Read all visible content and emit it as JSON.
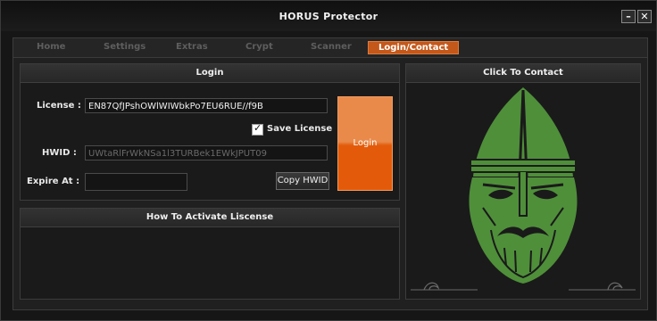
{
  "window": {
    "title": "HORUS  Protector",
    "minimize_icon": "minus",
    "close_icon": "x"
  },
  "tabs": [
    {
      "label": "Home",
      "active": false
    },
    {
      "label": "Settings",
      "active": false
    },
    {
      "label": "Extras",
      "active": false
    },
    {
      "label": "Crypt",
      "active": false
    },
    {
      "label": "Scanner",
      "active": false
    },
    {
      "label": "Login/Contact",
      "active": true
    }
  ],
  "login_panel": {
    "title": "Login",
    "license_label": "License :",
    "license_value": "EN87QfJPshOWlWIWbkPo7EU6RUE//f9B",
    "save_license_label": "Save License",
    "save_license_checked": true,
    "hwid_label": "HWID :",
    "hwid_value": "UWtaRlFrWkNSa1l3TURBek1EWkJPUT09",
    "expire_label": "Expire At  :",
    "expire_value": "",
    "login_button": "Login",
    "copy_hwid_button": "Copy HWID"
  },
  "activate_panel": {
    "title": "How To Activate Liscense"
  },
  "contact_panel": {
    "title": "Click To Contact",
    "image_icon": "viking-warrior-icon"
  },
  "colors": {
    "accent": "#e35b0a",
    "logo_green": "#4f8f3a",
    "background": "#1a1a1a"
  }
}
